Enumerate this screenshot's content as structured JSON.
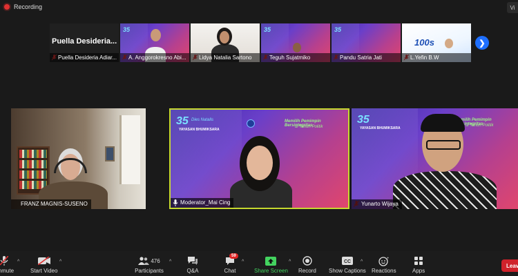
{
  "window": {
    "recording_label": "Recording",
    "view_label": "Vi"
  },
  "thumbnails": [
    {
      "name": "Puella Desideria Adiar...",
      "big_name": "Puella Desideria...",
      "kind": "blank",
      "muted": true
    },
    {
      "name": "A. Anggorokresno Abi...",
      "kind": "slide",
      "muted": true
    },
    {
      "name": "Lidya Natalia Sartono",
      "kind": "face",
      "muted": true
    },
    {
      "name": "Teguh Sujatmiko",
      "kind": "slide",
      "muted": true
    },
    {
      "name": "Pandu Satria Jati",
      "kind": "slide",
      "muted": true
    },
    {
      "name": "L.Yefin B.W",
      "kind": "white",
      "muted": true,
      "slide_text": "100s"
    }
  ],
  "gallery": [
    {
      "name": "FRANZ MAGNIS-SUSENO",
      "muted": false
    },
    {
      "name": "Moderator_Mai Cing",
      "muted": false,
      "active_speaker": true
    },
    {
      "name": "Yunarto Wijaya",
      "muted": true
    }
  ],
  "slide": {
    "logo": "35",
    "subtitle": "Dies Natalis",
    "org": "YAYASAN BHUMIKSARA",
    "headline": "Memilih Pemimpin Bersintegritas",
    "headline2": "di Tahun Politik"
  },
  "toolbar": {
    "unmute": "Unmute",
    "start_video": "Start Video",
    "participants": "Participants",
    "participants_count": "476",
    "qa": "Q&A",
    "chat": "Chat",
    "chat_badge": "59",
    "share_screen": "Share Screen",
    "record": "Record",
    "show_captions": "Show Captions",
    "reactions": "Reactions",
    "apps": "Apps",
    "leave": "Leav"
  },
  "colors": {
    "active_border": "#c7d92e",
    "share_green": "#43d35f",
    "leave_red": "#d0222b",
    "accent_blue": "#1e6fff"
  }
}
